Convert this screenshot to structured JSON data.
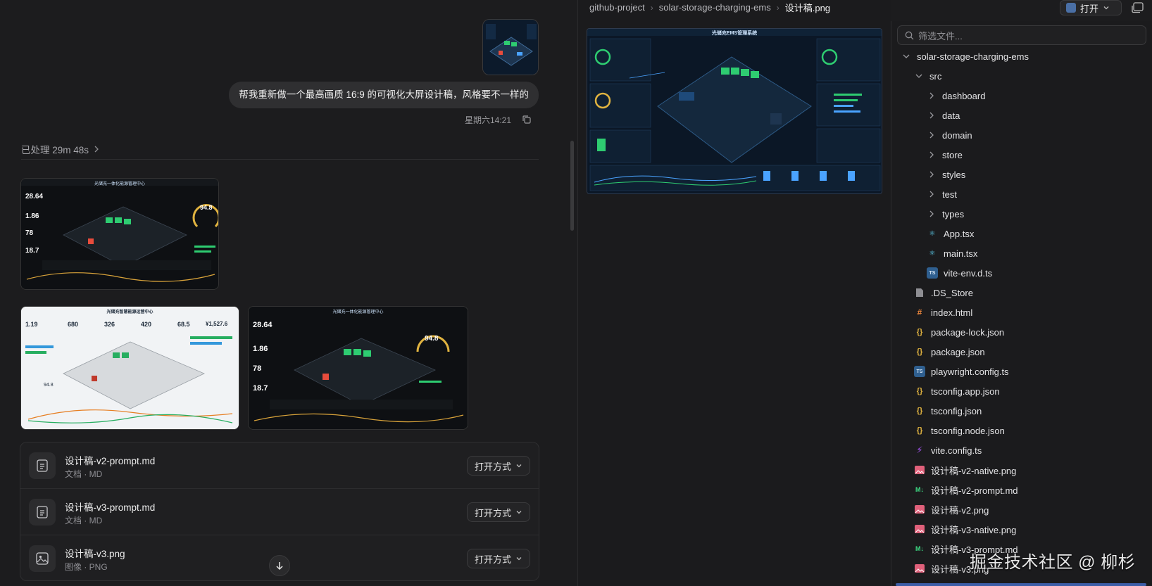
{
  "chat": {
    "message": "帮我重新做一个最高画质 16:9 的可视化大屏设计稿，风格要不一样的",
    "timestamp": "星期六14:21",
    "processed_label": "已处理 29m 48s",
    "shots": [
      {
        "title": "光储充一体化能源管理中心",
        "kpi1": "28.64",
        "kpi2": "1.86",
        "kpi3": "78",
        "kpi4": "18.7",
        "gauge": "94.8"
      },
      {
        "title": "光储充智慧能源运营中心",
        "kpi1": "1.19",
        "kpi2": "680",
        "kpi3": "326",
        "kpi4": "420",
        "kpi5": "68.5",
        "kpi6": "¥1,527.6",
        "gauge": "94.8"
      },
      {
        "title": "光储充一体化能源管理中心",
        "kpi1": "28.64",
        "kpi2": "1.86",
        "kpi3": "78",
        "kpi4": "18.7",
        "gauge": "94.8"
      }
    ],
    "files": [
      {
        "name": "设计稿-v2-prompt.md",
        "sub": "文档 · MD",
        "action": "打开方式"
      },
      {
        "name": "设计稿-v3-prompt.md",
        "sub": "文档 · MD",
        "action": "打开方式"
      },
      {
        "name": "设计稿-v3.png",
        "sub": "图像 · PNG",
        "action": "打开方式"
      }
    ]
  },
  "preview": {
    "breadcrumb": [
      "github-project",
      "solar-storage-charging-ems",
      "设计稿.png"
    ],
    "image_title": "光储充EMS管理系统",
    "open_label": "打开"
  },
  "tree": {
    "filter_placeholder": "筛选文件...",
    "root": "solar-storage-charging-ems",
    "src": "src",
    "folders": [
      "dashboard",
      "data",
      "domain",
      "store",
      "styles",
      "test",
      "types"
    ],
    "src_files": [
      "App.tsx",
      "main.tsx",
      "vite-env.d.ts"
    ],
    "root_files": [
      ".DS_Store",
      "index.html",
      "package-lock.json",
      "package.json",
      "playwright.config.ts",
      "tsconfig.app.json",
      "tsconfig.json",
      "tsconfig.node.json",
      "vite.config.ts",
      "设计稿-v2-native.png",
      "设计稿-v2-prompt.md",
      "设计稿-v2.png",
      "设计稿-v3-native.png",
      "设计稿-v3-prompt.md",
      "设计稿-v3.png"
    ]
  },
  "watermark": "掘金技术社区 @ 柳杉",
  "colors": {
    "accent_green": "#3ddc84",
    "accent_blue": "#4a90e2",
    "gold": "#e0b340",
    "selection": "#3d5ea8"
  }
}
